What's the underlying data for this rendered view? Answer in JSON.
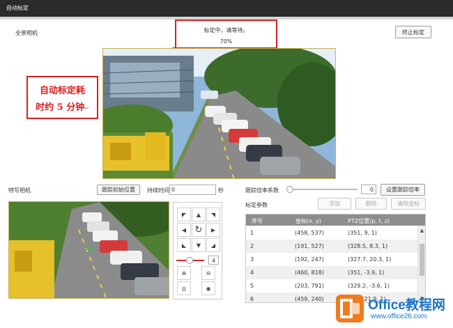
{
  "title": "自动标定",
  "panorama": {
    "label": "全景相机",
    "stop_button": "终止标定"
  },
  "progress_callout": {
    "message": "标定中，请等待。",
    "percent_text": "70%",
    "progress": 0.7
  },
  "annotation": {
    "line1": "自动标定耗",
    "line2": "时约 5 分钟",
    "return_mark": "↵",
    "color": "#d81e1e"
  },
  "speed_dome": {
    "label": "特写相机",
    "tracking_init_button": "跟踪初始位置",
    "duration_label": "持续时间",
    "duration_value": "0",
    "duration_unit": "秒",
    "zoom_step": "4",
    "controls": [
      "up-left-arrow",
      "up-arrow",
      "up-right-arrow",
      "left-arrow",
      "refresh-icon",
      "right-arrow",
      "down-left-arrow",
      "down-arrow",
      "down-right-arrow",
      "zoom-in-icon",
      "zoom-out-icon",
      "focus-near-icon",
      "focus-far-icon"
    ]
  },
  "tracking": {
    "ratio_label": "跟踪倍率系数",
    "ratio_value": "0",
    "set_ratio_button": "设置跟踪倍率",
    "params_label": "标定参数",
    "add_button": "添加",
    "delete_button": "删除",
    "clear_button": "清除坐标"
  },
  "table": {
    "headers": [
      "序号",
      "坐标(x, y)",
      "PTZ位置(p, t, z)"
    ],
    "rows": [
      [
        "1",
        "(458, 537)",
        "(351, 9, 1)"
      ],
      [
        "2",
        "(191, 527)",
        "(328.5, 8.3, 1)"
      ],
      [
        "3",
        "(192, 247)",
        "(327.7, 20.3, 1)"
      ],
      [
        "4",
        "(460, 818)",
        "(351, -3.9, 1)"
      ],
      [
        "5",
        "(203, 791)",
        "(329.2, -3.6, 1)"
      ],
      [
        "6",
        "(459, 240)",
        "(351, 21.9, 1)"
      ]
    ]
  },
  "watermark": {
    "brand": "Office教程网",
    "url": "www.office26.com"
  },
  "colors": {
    "titlebar": "#2b2b2b",
    "accent_red": "#d81e1e",
    "watermark_blue": "#1a73c9",
    "watermark_orange": "#f07a1e"
  }
}
